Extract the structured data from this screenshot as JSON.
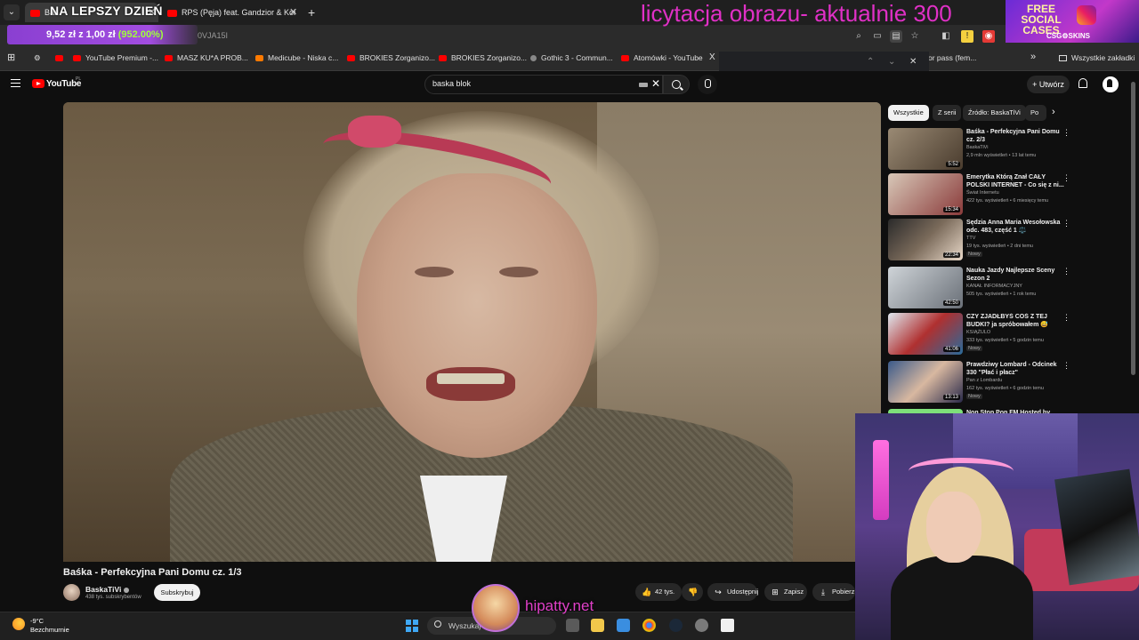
{
  "browser": {
    "tabs": [
      {
        "label": "Baś",
        "close": "✕"
      },
      {
        "label": "RPS (Pęja) feat. Gandzior & Koł",
        "close": "✕"
      }
    ],
    "tab_menu": "⌄",
    "new_tab": "+",
    "url_fragment": "0VJA15I",
    "bookmarks": [
      {
        "label": ""
      },
      {
        "label": "YouTube Premium -..."
      },
      {
        "label": "MASZ KU*A PROB..."
      },
      {
        "label": "Medicube - Niska c..."
      },
      {
        "label": "BROKIES Zorganizo..."
      },
      {
        "label": "BROKIES Zorganizo..."
      },
      {
        "label": "Gothic 3 - Commun..."
      },
      {
        "label": "Atomówki - YouTube"
      },
      {
        "label": "X"
      },
      {
        "label": "or pass (fem..."
      },
      {
        "label": "»"
      },
      {
        "label": "Wszystkie zakładki"
      }
    ],
    "findbar": {
      "up": "⌃",
      "down": "⌄",
      "close": "✕"
    }
  },
  "overlays": {
    "stream_title": "NA LEPSZY DZIEŃ",
    "bid": {
      "amount": "9,52 zł",
      "middle": "z",
      "start": "1,00 zł",
      "pct": "(952.00%)"
    },
    "auction_text": "licytacja obrazu-  aktualnie 300",
    "promo": {
      "line1": "FREE",
      "line2": "SOCIAL",
      "line3": "CASES",
      "brand": "CSG⚙SKINS"
    },
    "streamer_url": "hipatty.net"
  },
  "youtube": {
    "logo_text": "YouTube",
    "logo_sup": "PL",
    "search_value": "baska blok",
    "create_label": "+ Utwórz",
    "video": {
      "title": "Baśka - Perfekcyjna Pani Domu cz. 1/3",
      "channel": "BaskaTiVi",
      "subscribers": "438 tys. subskrybentów",
      "subscribe_label": "Subskrybuj",
      "likes": "42 tys.",
      "share_label": "Udostępnij",
      "save_label": "Zapisz",
      "download_label": "Pobierz"
    },
    "chips": [
      {
        "label": "Wszystkie",
        "active": true
      },
      {
        "label": "Z serii",
        "active": false
      },
      {
        "label": "Źródło: BaskaTiVi",
        "active": false
      },
      {
        "label": "Po",
        "active": false
      }
    ],
    "chip_next": "›",
    "recommendations": [
      {
        "title": "Baśka - Perfekcyjna Pani Domu cz. 2/3",
        "channel": "BaskaTiVi",
        "meta": "2,9 mln wyświetleń • 13 lat temu",
        "duration": "5:52",
        "badge": ""
      },
      {
        "title": "Emerytka Którą Znał CAŁY POLSKI INTERNET - Co się z ni...",
        "channel": "Świat Internetu",
        "meta": "422 tys. wyświetleń • 6 miesięcy temu",
        "duration": "15:34",
        "badge": ""
      },
      {
        "title": "Sędzia Anna Maria Wesołowska odc. 483, część 1 ⚖️",
        "channel": "TTV",
        "meta": "19 tys. wyświetleń • 2 dni temu",
        "duration": "22:34",
        "badge": "Nowy"
      },
      {
        "title": "Nauka Jazdy Najlepsze Sceny Sezon 2",
        "channel": "KANAŁ INFORMACYJNY",
        "meta": "505 tys. wyświetleń • 1 rok temu",
        "duration": "42:50",
        "badge": ""
      },
      {
        "title": "CZY ZJADŁBYŚ COŚ Z TEJ BUDKI? ja spróbowałem 😅",
        "channel": "KSIĄŻULO",
        "meta": "333 tys. wyświetleń • 5 godzin temu",
        "duration": "41:06",
        "badge": "Nowy"
      },
      {
        "title": "Prawdziwy Lombard - Odcinek 330 \"Płać i płacz\"",
        "channel": "Pan z Lombardu",
        "meta": "162 tys. wyświetleń • 6 godzin temu",
        "duration": "13:13",
        "badge": "Nowy"
      },
      {
        "title": "Non Stop Pop FM Hosted by",
        "channel": "",
        "meta": "",
        "duration": "",
        "badge": ""
      }
    ]
  },
  "taskbar": {
    "temperature": "-9°C",
    "weather": "Bezchmurnie",
    "search_placeholder": "Wyszukaj"
  },
  "colors": {
    "accent_red": "#ff0000",
    "auction_magenta": "#e030c6",
    "bid_purple": "#a24de0",
    "bid_green": "#9fff3a"
  }
}
